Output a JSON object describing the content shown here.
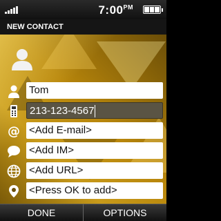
{
  "status": {
    "time": "7:00",
    "time_suffix": "PM"
  },
  "title": "NEW CONTACT",
  "fields": [
    {
      "icon": "person-icon",
      "value": "Tom"
    },
    {
      "icon": "phone-icon",
      "value": "213-123-4567"
    },
    {
      "icon": "at-icon",
      "value": "<Add E-mail>"
    },
    {
      "icon": "chat-bubble-icon",
      "value": "<Add IM>"
    },
    {
      "icon": "globe-icon",
      "value": "<Add URL>"
    },
    {
      "icon": "location-pin-icon",
      "value": "<Press OK to add>"
    }
  ],
  "softkeys": {
    "left": "DONE",
    "right": "OPTIONS"
  }
}
